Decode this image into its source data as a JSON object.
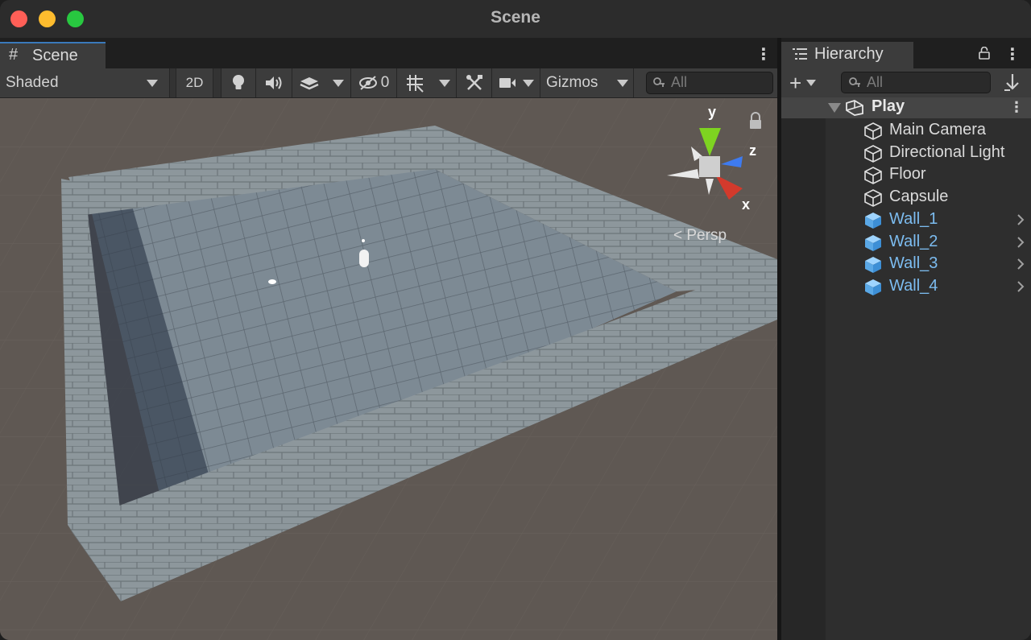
{
  "window": {
    "title": "Scene"
  },
  "scene_panel": {
    "tab_label": "Scene",
    "toolbar": {
      "shading_mode": "Shaded",
      "toggle_2d": "2D",
      "hidden_count": "0",
      "gizmos_label": "Gizmos",
      "search_placeholder": "All"
    },
    "viewport": {
      "axis_labels": {
        "x": "x",
        "y": "y",
        "z": "z"
      },
      "projection_label": "Persp"
    }
  },
  "hierarchy_panel": {
    "tab_label": "Hierarchy",
    "search_placeholder": "All",
    "scene_name": "Play",
    "items": [
      {
        "label": "Main Camera",
        "type": "gameobject",
        "has_children": false
      },
      {
        "label": "Directional Light",
        "type": "gameobject",
        "has_children": false
      },
      {
        "label": "Floor",
        "type": "gameobject",
        "has_children": false
      },
      {
        "label": "Capsule",
        "type": "gameobject",
        "has_children": false
      },
      {
        "label": "Wall_1",
        "type": "prefab",
        "has_children": true
      },
      {
        "label": "Wall_2",
        "type": "prefab",
        "has_children": true
      },
      {
        "label": "Wall_3",
        "type": "prefab",
        "has_children": true
      },
      {
        "label": "Wall_4",
        "type": "prefab",
        "has_children": true
      }
    ]
  },
  "colors": {
    "prefab_text": "#7cbcf0",
    "object_text": "#dadada",
    "active_tab_accent": "#3a79bb"
  }
}
